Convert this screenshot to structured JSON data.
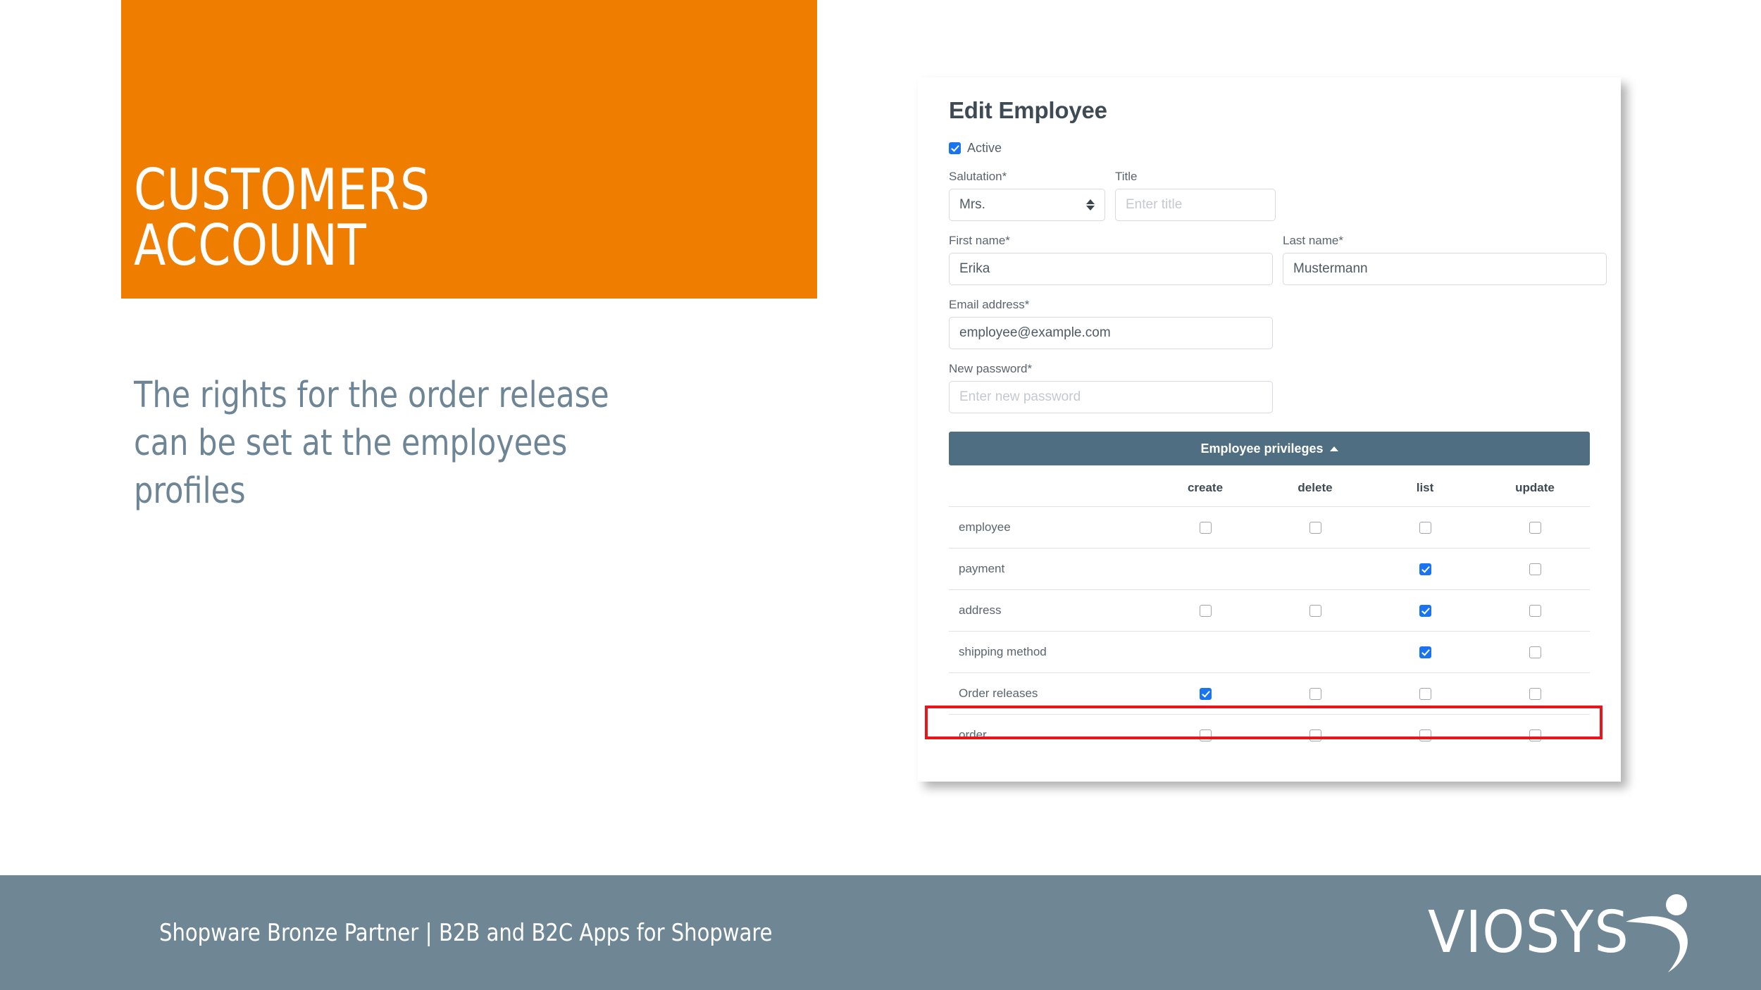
{
  "slide": {
    "title": "CUSTOMERS\nACCOUNT",
    "lead": "The rights for the order release can be set at the employees profiles",
    "accent_orange": "#EF7D00",
    "accent_slate": "#6F8794"
  },
  "app": {
    "form_title": "Edit Employee",
    "active": {
      "label": "Active",
      "checked": true
    },
    "fields": {
      "salutation": {
        "label": "Salutation*",
        "value": "Mrs."
      },
      "title": {
        "label": "Title",
        "value": "",
        "placeholder": "Enter title"
      },
      "first_name": {
        "label": "First name*",
        "value": "Erika"
      },
      "last_name": {
        "label": "Last name*",
        "value": "Mustermann"
      },
      "email": {
        "label": "Email address*",
        "value": "employee@example.com"
      },
      "password": {
        "label": "New password*",
        "value": "",
        "placeholder": "Enter new password"
      }
    },
    "privileges": {
      "header": "Employee privileges",
      "collapse_icon": "caret-up-icon",
      "columns": [
        "create",
        "delete",
        "list",
        "update"
      ],
      "rows": [
        {
          "name": "employee",
          "create": false,
          "delete": false,
          "list": false,
          "update": false,
          "show": [
            true,
            true,
            true,
            true
          ],
          "highlighted": false
        },
        {
          "name": "payment",
          "create": null,
          "delete": null,
          "list": true,
          "update": false,
          "show": [
            false,
            false,
            true,
            true
          ],
          "highlighted": false
        },
        {
          "name": "address",
          "create": false,
          "delete": false,
          "list": true,
          "update": false,
          "show": [
            true,
            true,
            true,
            true
          ],
          "highlighted": false
        },
        {
          "name": "shipping method",
          "create": null,
          "delete": null,
          "list": true,
          "update": false,
          "show": [
            false,
            false,
            true,
            true
          ],
          "highlighted": false
        },
        {
          "name": "Order releases",
          "create": true,
          "delete": false,
          "list": false,
          "update": false,
          "show": [
            true,
            true,
            true,
            true
          ],
          "highlighted": true
        },
        {
          "name": "order",
          "create": false,
          "delete": false,
          "list": false,
          "update": false,
          "show": [
            true,
            true,
            true,
            true
          ],
          "highlighted": false
        }
      ],
      "bar_color": "#506E82",
      "checked_color": "#1A73F0",
      "highlight_color": "#E8161B"
    }
  },
  "footer": {
    "line_left": "Shopware Bronze Partner",
    "separator": "|",
    "line_right": "B2B and B2C Apps for Shopware",
    "logo_text": "VIOSYS"
  }
}
